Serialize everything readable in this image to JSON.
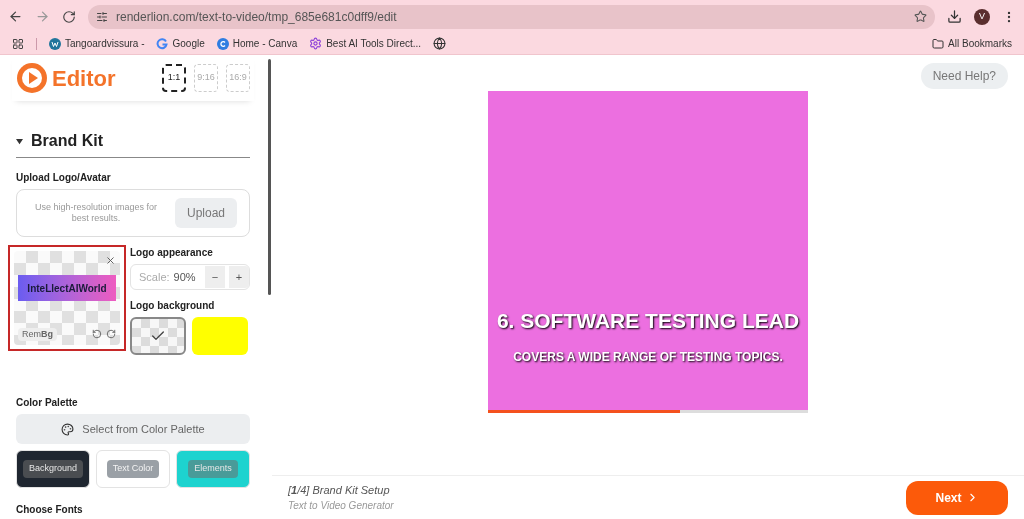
{
  "browser": {
    "url": "renderlion.com/text-to-video/tmp_685e681c0dff9/edit",
    "profile": "V",
    "bookmarks": [
      {
        "label": "Tangoardvissura -",
        "kind": "wordpress"
      },
      {
        "label": "Google",
        "kind": "google"
      },
      {
        "label": "Home - Canva",
        "kind": "canva"
      },
      {
        "label": "Best AI Tools Direct...",
        "kind": "gear"
      },
      {
        "kind": "globe"
      }
    ],
    "all_bookmarks": "All Bookmarks"
  },
  "editor": {
    "title": "Editor",
    "ratios": [
      {
        "label": "1:1",
        "selected": true
      },
      {
        "label": "9:16",
        "selected": false
      },
      {
        "label": "16:9",
        "selected": false
      }
    ],
    "brand_kit": {
      "title": "Brand Kit",
      "expanded": true,
      "upload_label": "Upload Logo/Avatar",
      "upload_hint": "Use high-resolution images for best results.",
      "upload_button": "Upload",
      "logo": {
        "text": "InteLlectAIWorld",
        "remove_bg": "Rem**Bg**"
      },
      "appearance_label": "Logo appearance",
      "scale_label": "Scale:",
      "scale_value": "90%",
      "minus": "−",
      "plus": "+",
      "background_label": "Logo background",
      "backgrounds": [
        {
          "kind": "transparent",
          "selected": true
        },
        {
          "kind": "color",
          "color": "#ffff00",
          "selected": false
        }
      ],
      "palette_label": "Color Palette",
      "palette_button": "Select from Color Palette",
      "swatches": [
        {
          "label": "Background",
          "color": "#1f2630"
        },
        {
          "label": "Text Color",
          "color": "#ffffff"
        },
        {
          "label": "Elements",
          "color": "#1dd3cf"
        }
      ],
      "fonts_label": "Choose Fonts"
    }
  },
  "main": {
    "help": "Need Help?",
    "preview": {
      "captions": [
        "6. SOFTWARE TESTING LEAD",
        "COVERS A WIDE RANGE OF TESTING TOPICS."
      ],
      "level": 0.6
    },
    "footer": {
      "step": "[**1**/4] Brand Kit Setup",
      "subtitle": "Text to Video Generator",
      "next": "Next"
    }
  }
}
